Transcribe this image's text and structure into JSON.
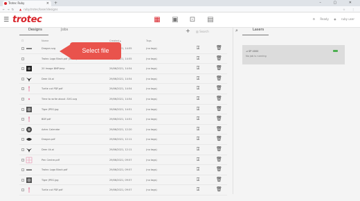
{
  "browser": {
    "tab_title": "Trotec Ruby",
    "url": "ruby.trotec/laser/designs",
    "window_controls": "– ▢ ✕"
  },
  "app": {
    "logo": "trotec",
    "user": "ruby user",
    "laser_status_short": "Ready"
  },
  "tabs": {
    "designs": "Designs",
    "jobs": "Jobs"
  },
  "search": {
    "placeholder": "Search"
  },
  "columns": {
    "name": "Name",
    "created": "Created",
    "tags": "Tags"
  },
  "rows": [
    {
      "name": "Dragon.svg",
      "date": "29/06/2021, 14:55",
      "tags": "(no tags)",
      "thumb": "dash"
    },
    {
      "name": "Trotec Logo Black.pdf (lower)",
      "date": "29/06/2021, 14:55",
      "tags": "(no tags)",
      "thumb": "none"
    },
    {
      "name": "20 Image BMP.bmp",
      "date": "29/06/2021, 14:54",
      "tags": "(no tags)",
      "thumb": "dark"
    },
    {
      "name": "Deer 4k.ai",
      "date": "29/06/2021, 14:54",
      "tags": "(no tags)",
      "thumb": "deer"
    },
    {
      "name": "Turtle cut PDF.pdf",
      "date": "29/06/2021, 14:54",
      "tags": "(no tags)",
      "thumb": "pink"
    },
    {
      "name": "Time to write about .SVG.svg",
      "date": "29/06/2021, 14:54",
      "tags": "(no tags)",
      "thumb": "pinkdot"
    },
    {
      "name": "Tiger JPEG.jpg",
      "date": "29/06/2021, 14:51",
      "tags": "(no tags)",
      "thumb": "tiger"
    },
    {
      "name": "BDF.pdf",
      "date": "29/06/2021, 14:51",
      "tags": "(no tags)",
      "thumb": "pink"
    },
    {
      "name": "Aztec Calendar",
      "date": "29/06/2021, 12:20",
      "tags": "(no tags)",
      "thumb": "aztec"
    },
    {
      "name": "Dragon.pdf",
      "date": "29/06/2021, 12:11",
      "tags": "(no tags)",
      "thumb": "dragon"
    },
    {
      "name": "Deer 4k.ai",
      "date": "29/06/2021, 12:11",
      "tags": "(no tags)",
      "thumb": "deer"
    },
    {
      "name": "Pen Centre.pdf",
      "date": "29/06/2021, 09:57",
      "tags": "(no tags)",
      "thumb": "grid"
    },
    {
      "name": "Trotec Logo Black.pdf",
      "date": "29/06/2021, 09:57",
      "tags": "(no tags)",
      "thumb": "dash"
    },
    {
      "name": "Tiger JPEG.jpg",
      "date": "29/06/2021, 09:57",
      "tags": "(no tags)",
      "thumb": "tiger"
    },
    {
      "name": "Turtle cut PDF.pdf",
      "date": "29/06/2021, 09:57",
      "tags": "(no tags)",
      "thumb": "pink"
    }
  ],
  "callout": {
    "text": "Select file"
  },
  "laser": {
    "title": "Lasers",
    "name": "SP 4000",
    "status": "No job is running"
  },
  "colors": {
    "brand": "#d8232a",
    "callout": "#e9534c",
    "led": "#4caf50"
  },
  "icons": {
    "nav": [
      "designs-icon",
      "layers-icon",
      "laser-icon",
      "library-icon"
    ],
    "row_actions": [
      "send-to-laser-icon",
      "delete-icon"
    ]
  }
}
